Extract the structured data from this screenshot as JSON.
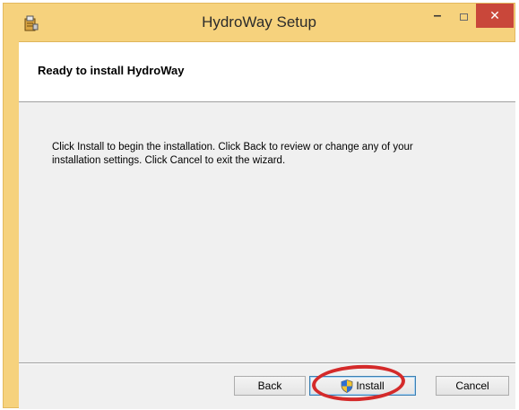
{
  "window": {
    "title": "HydroWay Setup",
    "icons": {
      "app": "installer-package-icon",
      "minimize": "minimize-icon",
      "maximize": "maximize-icon",
      "close": "close-icon"
    },
    "colors": {
      "frame": "#f6d27d",
      "close_button": "#c9473a"
    }
  },
  "banner": {
    "title": "Ready to install HydroWay"
  },
  "body": {
    "message": "Click Install to begin the installation. Click Back to review or change any of your installation settings. Click Cancel to exit the wizard."
  },
  "buttons": {
    "back": "Back",
    "install": "Install",
    "cancel": "Cancel",
    "install_icon": "uac-shield-icon"
  },
  "annotation": {
    "highlight": "red-circle",
    "color": "#d42a2a"
  }
}
